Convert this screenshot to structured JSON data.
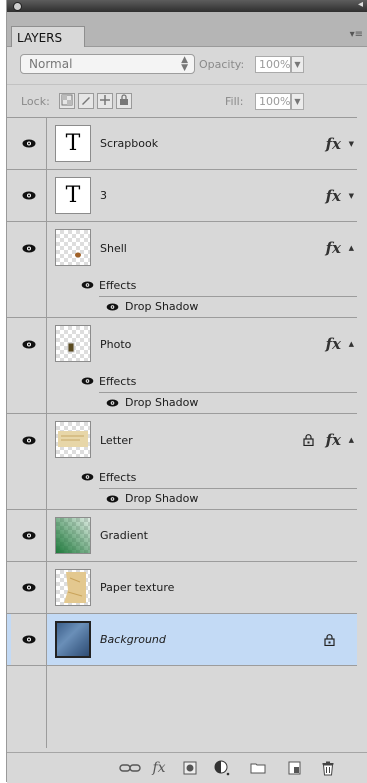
{
  "panel": {
    "tab_label": "LAYERS",
    "menu_icon": "panel-menu-icon",
    "blend_mode": "Normal",
    "opacity_label": "Opacity:",
    "opacity_value": "100%",
    "lock_label": "Lock:",
    "fill_label": "Fill:",
    "fill_value": "100%",
    "lock_icons": [
      "lock-transparent-icon",
      "lock-image-icon",
      "lock-position-icon",
      "lock-all-icon"
    ]
  },
  "layers": [
    {
      "name": "Scrapbook",
      "kind": "text",
      "thumb_glyph": "T",
      "fx": "fx",
      "expanded": false,
      "locked": false,
      "selected": false
    },
    {
      "name": "3",
      "kind": "text",
      "thumb_glyph": "T",
      "fx": "fx",
      "expanded": false,
      "locked": false,
      "selected": false
    },
    {
      "name": "Shell",
      "kind": "image",
      "fx": "fx",
      "expanded": true,
      "locked": false,
      "selected": false,
      "effects_label": "Effects",
      "effect": "Drop Shadow"
    },
    {
      "name": "Photo",
      "kind": "image",
      "fx": "fx",
      "expanded": true,
      "locked": false,
      "selected": false,
      "effects_label": "Effects",
      "effect": "Drop Shadow"
    },
    {
      "name": "Letter",
      "kind": "image",
      "fx": "fx",
      "expanded": true,
      "locked": true,
      "selected": false,
      "effects_label": "Effects",
      "effect": "Drop Shadow"
    },
    {
      "name": "Gradient",
      "kind": "image",
      "expanded": false,
      "locked": false,
      "selected": false
    },
    {
      "name": "Paper texture",
      "kind": "image",
      "expanded": false,
      "locked": false,
      "selected": false
    },
    {
      "name": "Background",
      "kind": "image",
      "expanded": false,
      "locked": true,
      "selected": true
    }
  ],
  "footer": {
    "icons": [
      "link-layers-icon",
      "layer-style-icon",
      "layer-mask-icon",
      "adjustment-layer-icon",
      "new-group-icon",
      "new-layer-icon",
      "delete-layer-icon"
    ],
    "fx_label": "fx"
  },
  "colors": {
    "selected_row": "#c3daf5",
    "panel_bg": "#d8d8d8"
  }
}
